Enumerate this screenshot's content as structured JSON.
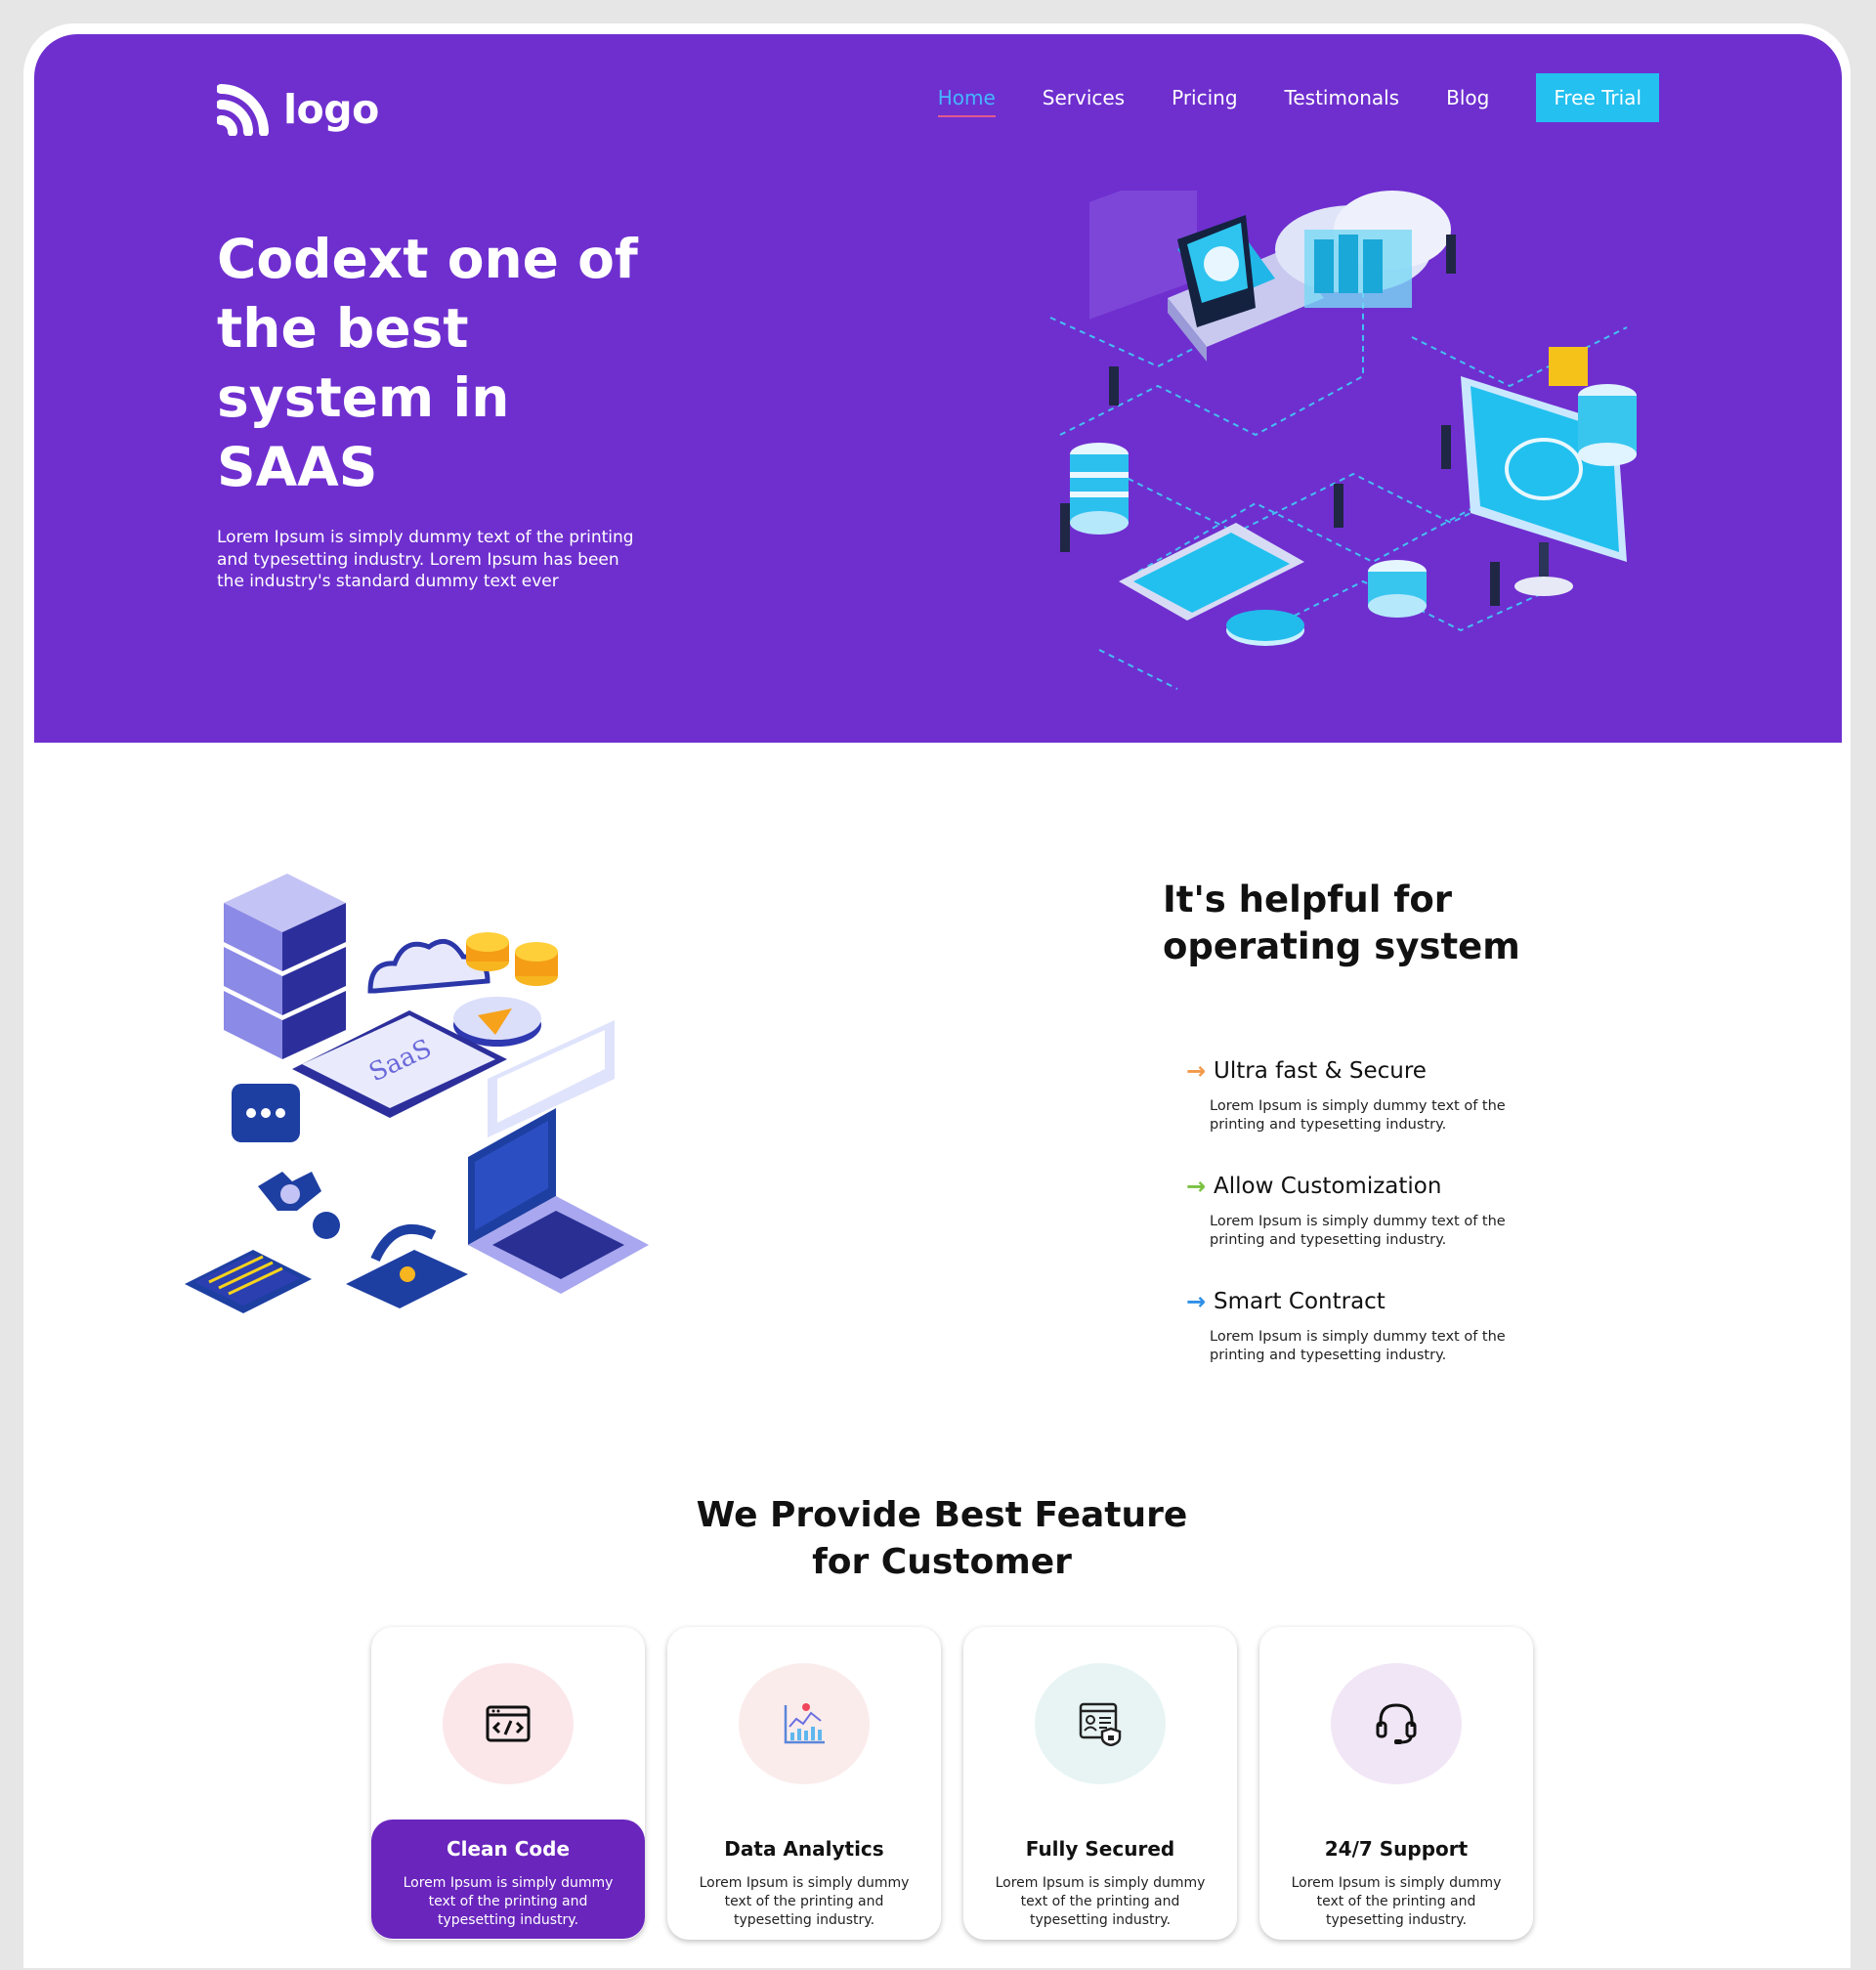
{
  "header": {
    "logo_text": "logo",
    "nav": [
      {
        "label": "Home",
        "active": true
      },
      {
        "label": "Services"
      },
      {
        "label": "Pricing"
      },
      {
        "label": "Testimonals"
      },
      {
        "label": "Blog"
      }
    ],
    "cta_label": "Free Trial"
  },
  "hero": {
    "title": "Codext one of the best system in SAAS",
    "description": "Lorem Ipsum is simply dummy text of the printing and typesetting industry. Lorem Ipsum has been the industry's standard dummy text ever"
  },
  "helpful": {
    "title": "It's helpful for operating system",
    "items": [
      {
        "title": "Ultra fast & Secure",
        "description": "Lorem Ipsum is simply dummy text of the printing and typesetting industry.",
        "arrow_color": "#f39a4a"
      },
      {
        "title": "Allow Customization",
        "description": "Lorem Ipsum is simply dummy text of the printing and typesetting industry.",
        "arrow_color": "#7ac142"
      },
      {
        "title": "Smart Contract",
        "description": "Lorem Ipsum is simply dummy text of the printing and typesetting industry.",
        "arrow_color": "#2f8fe6"
      }
    ],
    "illustration_label": "SaaS"
  },
  "features": {
    "title": "We Provide Best Feature for Customer",
    "cards": [
      {
        "title": "Clean Code",
        "description": "Lorem Ipsum is simply dummy text of the printing and typesetting industry.",
        "icon": "code-window-icon",
        "circle_color": "#fbe7ea",
        "active": true
      },
      {
        "title": "Data Analytics",
        "description": "Lorem Ipsum is simply dummy text of the printing and typesetting industry.",
        "icon": "analytics-chart-icon",
        "circle_color": "#fbecec"
      },
      {
        "title": "Fully Secured",
        "description": "Lorem Ipsum is simply dummy text of the printing and typesetting industry.",
        "icon": "secure-document-icon",
        "circle_color": "#e8f4f4"
      },
      {
        "title": "24/7 Support",
        "description": "Lorem Ipsum is simply dummy text of the printing and typesetting industry.",
        "icon": "headset-icon",
        "circle_color": "#f1e6f6"
      }
    ]
  },
  "colors": {
    "hero_bg": "#6f2fcf",
    "cta_bg": "#23c0f0",
    "active_card_bg": "#6a25bd"
  }
}
